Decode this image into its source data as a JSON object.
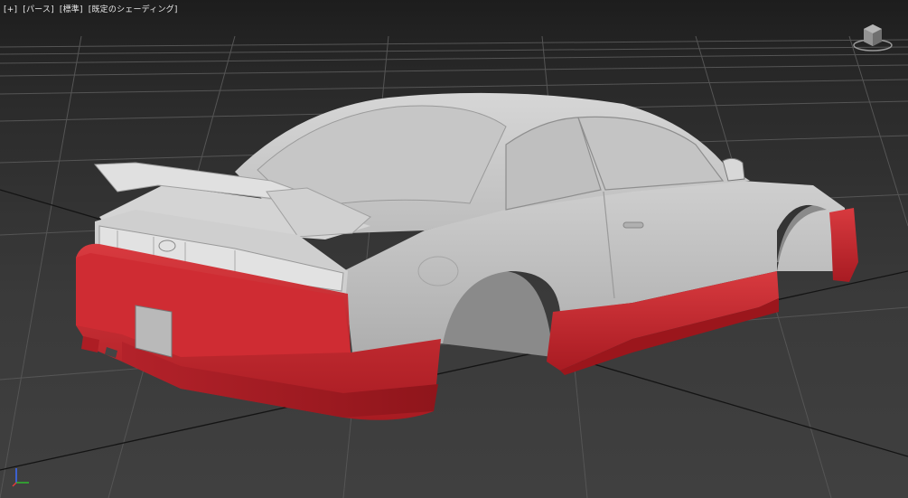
{
  "viewport": {
    "menu": {
      "plus_label": "[+]",
      "view_label": "[パース]",
      "preset_label": "[標準]",
      "shading_label": "[既定のシェーディング]"
    },
    "viewcube_icon": "viewcube-icon",
    "axis_icon": "axis-tripod-icon",
    "colors": {
      "background": "#3a3a3a",
      "grid": "#5a5a5a",
      "body_gray": "#c8c8c8",
      "bodykit_red": "#c8242b"
    }
  }
}
